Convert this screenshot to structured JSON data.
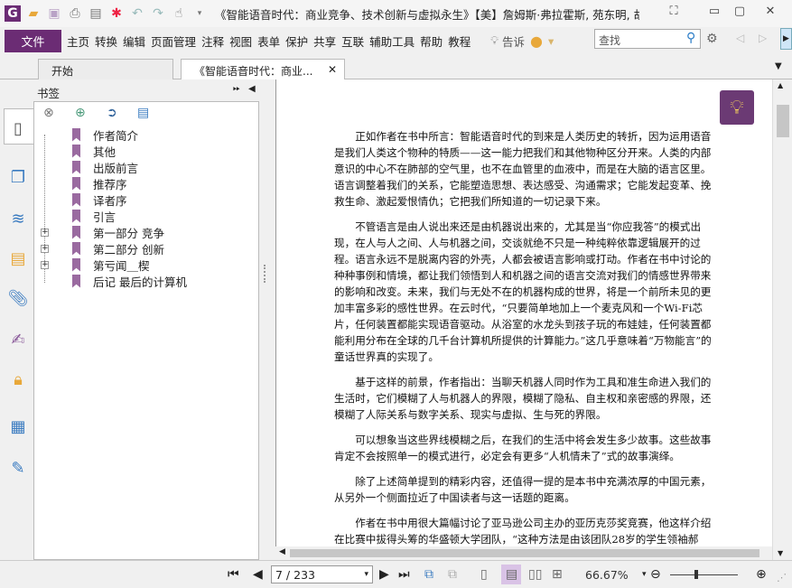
{
  "window": {
    "title": "《智能语音时代：商业竞争、技术创新与虚拟永生》【美】詹姆斯·弗拉霍斯, 苑东明, 胡..."
  },
  "menu": {
    "file": "文件",
    "items": [
      "主页",
      "转换",
      "编辑",
      "页面管理",
      "注释",
      "视图",
      "表单",
      "保护",
      "共享",
      "互联",
      "辅助工具",
      "帮助",
      "教程"
    ],
    "tell": "告诉",
    "search_placeholder": "查找"
  },
  "tabs": [
    {
      "label": "开始"
    },
    {
      "label": "《智能语音时代：商业..."
    }
  ],
  "bookmarks": {
    "title": "书签",
    "items": [
      {
        "label": "作者简介",
        "expandable": false
      },
      {
        "label": "其他",
        "expandable": false
      },
      {
        "label": "出版前言",
        "expandable": false
      },
      {
        "label": "推荐序",
        "expandable": false
      },
      {
        "label": "译者序",
        "expandable": false
      },
      {
        "label": "引言",
        "expandable": false
      },
      {
        "label": "第一部分 竞争",
        "expandable": true
      },
      {
        "label": "第二部分 创新",
        "expandable": true
      },
      {
        "label": "第亏闻＿楔",
        "expandable": true
      },
      {
        "label": "后记 最后的计算机",
        "expandable": false
      }
    ]
  },
  "document": {
    "paragraphs": [
      "正如作者在书中所言：智能语音时代的到来是人类历史的转折，因为运用语音是我们人类这个物种的特质——这一能力把我们和其他物种区分开来。人类的内部意识的中心不在肺部的空气里，也不在血管里的血液中，而是在大脑的语言区里。语言调整着我们的关系，它能塑造思想、表达感受、沟通需求；它能发起变革、挽救生命、激起爱恨情仇；它把我们所知道的一切记录下来。",
      "不管语言是由人说出来还是由机器说出来的，尤其是当“你应我答”的模式出现，在人与人之间、人与机器之间，交谈就绝不只是一种纯粹依靠逻辑展开的过程。语言永远不是脱离内容的外壳，人都会被语言影响或打动。作者在书中讨论的种种事例和情境，都让我们领悟到人和机器之间的语言交流对我们的情感世界带来的影响和改变。未来，我们与无处不在的机器构成的世界，将是一个前所未见的更加丰富多彩的感性世界。在云时代，“只要简单地加上一个麦克风和一个Wi-Fi芯片，任何装置都能实现语音驱动。从浴室的水龙头到孩子玩的布娃娃，任何装置都能利用分布在全球的几千台计算机所提供的计算能力。”这几乎意味着“万物能言”的童话世界真的实现了。",
      "基于这样的前景，作者指出：当聊天机器人同时作为工具和准生命进入我们的生活时，它们模糊了人与机器人的界限，模糊了隐私、自主权和亲密感的界限，还模糊了人际关系与数字关系、现实与虚拟、生与死的界限。",
      "可以想象当这些界线模糊之后，在我们的生活中将会发生多少故事。这些故事肯定不会按照单一的模式进行，必定会有更多“人机情未了”式的故事演绎。",
      "除了上述简单提到的精彩内容，还值得一提的是本书中充满浓厚的中国元素，从另外一个侧面拉近了中国读者与这一话题的距离。",
      "作者在书中用很大篇幅讨论了亚马逊公司主办的亚历克莎奖竞赛，他这样介绍在比赛中拔得头筹的华盛顿大学团队，“这种方法是由该团队28岁的学生领袖郝"
    ]
  },
  "status": {
    "page": "7 / 233",
    "zoom": "66.67%",
    "zoom_slider_fraction": 0.33
  },
  "colors": {
    "accent": "#6b2c74",
    "bookmark": "#9a6aa0"
  }
}
